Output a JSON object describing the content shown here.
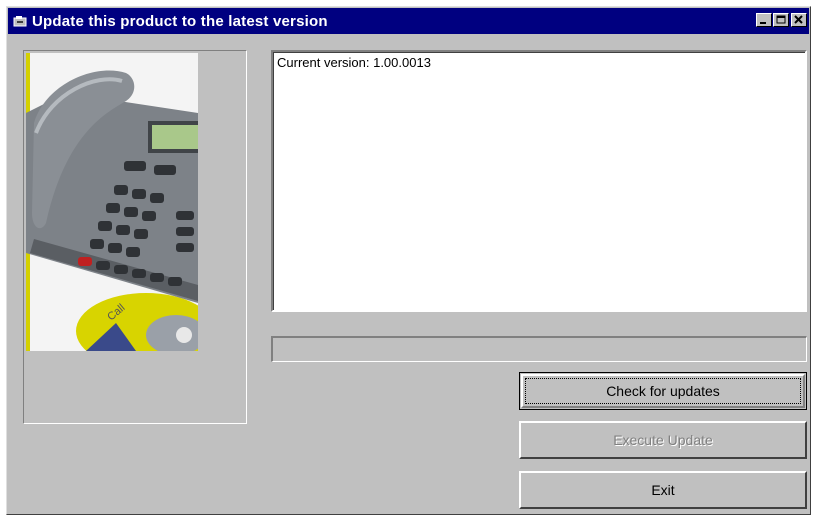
{
  "window": {
    "title": "Update this product to the latest version",
    "controls": [
      "minimize-icon",
      "maximize-icon",
      "close-icon"
    ]
  },
  "info_box": {
    "text": "Current version: 1.00.0013"
  },
  "progress": {
    "fraction": 0
  },
  "buttons": {
    "check": "Check for updates",
    "execute": "Execute Update",
    "exit": "Exit"
  },
  "colors": {
    "titlebar": "#000080",
    "face": "#c0c0c0",
    "photo_accent": "#d4d000"
  }
}
